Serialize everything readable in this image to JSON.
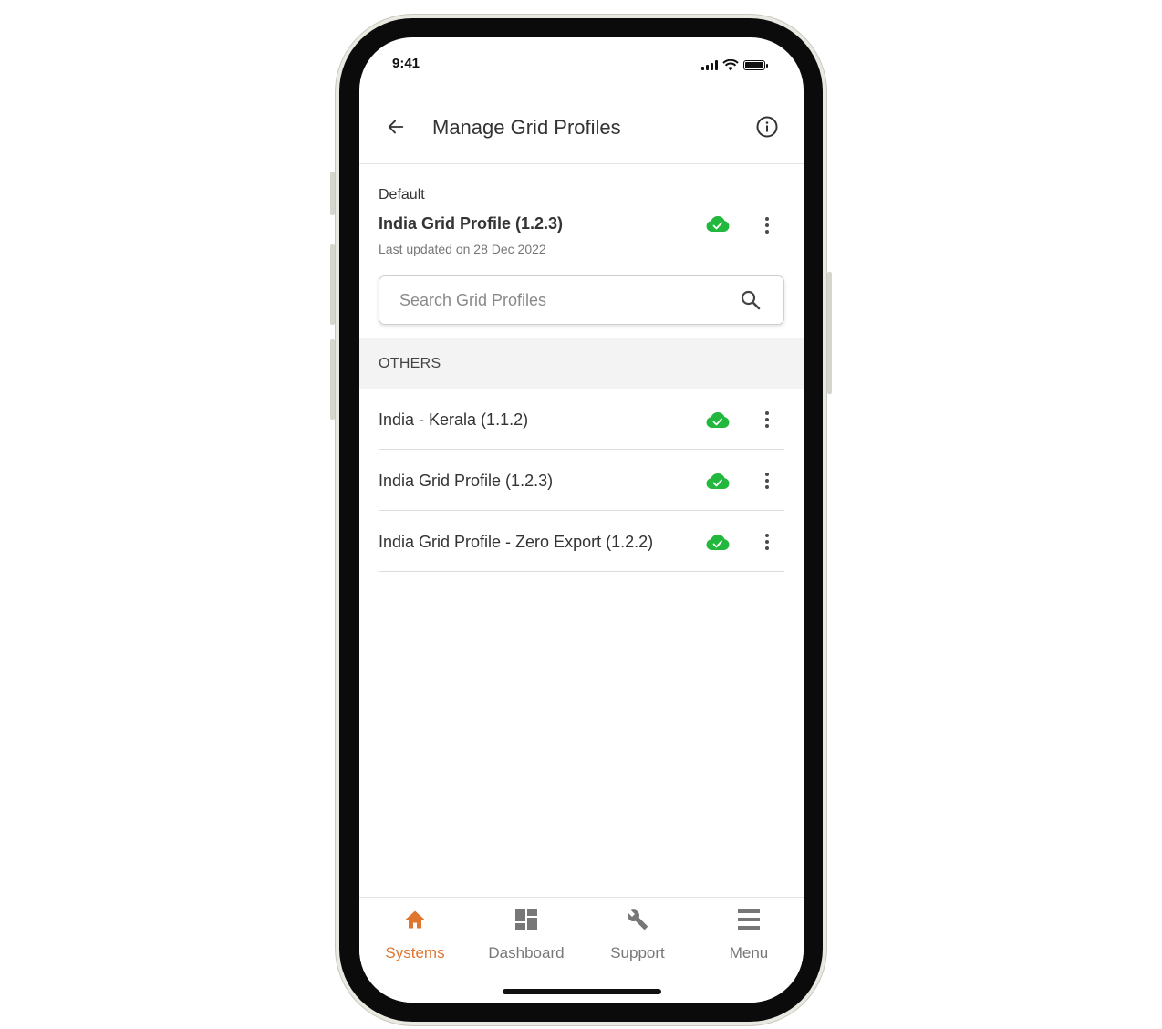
{
  "status_bar": {
    "time": "9:41"
  },
  "header": {
    "title": "Manage Grid Profiles"
  },
  "default_profile": {
    "label": "Default",
    "name": "India Grid Profile (1.2.3)",
    "updated": "Last updated on 28 Dec 2022"
  },
  "search": {
    "placeholder": "Search Grid Profiles",
    "value": ""
  },
  "others": {
    "label": "OTHERS",
    "items": [
      {
        "name": "India - Kerala (1.1.2)"
      },
      {
        "name": "India Grid Profile (1.2.3)"
      },
      {
        "name": "India Grid Profile - Zero Export (1.2.2)"
      }
    ]
  },
  "nav": {
    "items": [
      {
        "label": "Systems",
        "icon": "home-icon",
        "active": true
      },
      {
        "label": "Dashboard",
        "icon": "dashboard-icon",
        "active": false
      },
      {
        "label": "Support",
        "icon": "wrench-icon",
        "active": false
      },
      {
        "label": "Menu",
        "icon": "menu-icon",
        "active": false
      }
    ]
  },
  "colors": {
    "accent": "#e0752e",
    "cloud_status": "#22b83d",
    "text_primary": "#333333",
    "text_secondary": "#777777"
  }
}
